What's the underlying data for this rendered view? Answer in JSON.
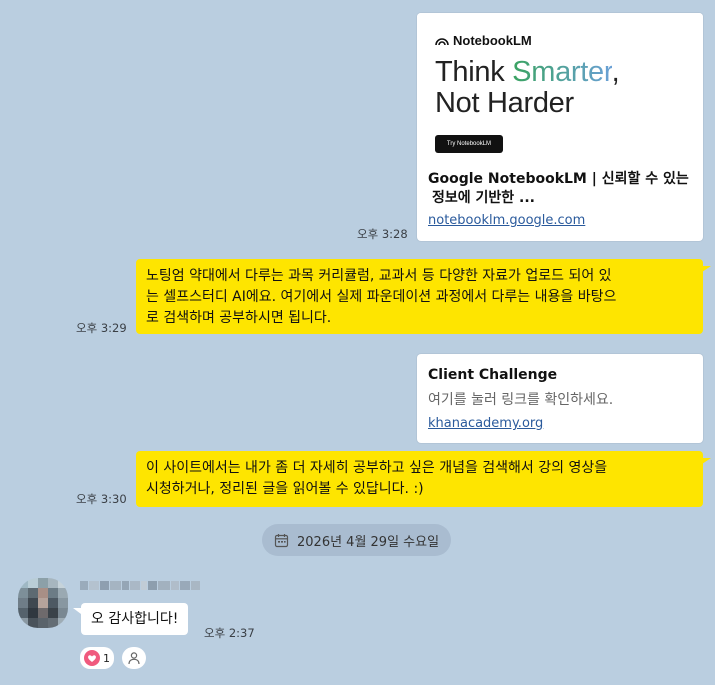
{
  "messages": {
    "link1": {
      "time": "오후 3:28",
      "brand": "NotebookLM",
      "hero_line1_a": "Think ",
      "hero_line1_b": "Smarter",
      "hero_line1_c": ",",
      "hero_line2": "Not Harder",
      "cta": "Try NotebookLM",
      "title_line1": "Google NotebookLM | 신뢰할 수 있는",
      "title_line2": "정보에 기반한 ...",
      "url": "notebooklm.google.com"
    },
    "text1": {
      "time": "오후 3:29",
      "line1": "노팅엄 약대에서 다루는 과목 커리큘럼, 교과서 등 다양한 자료가 업로드 되어 있",
      "line2": "는 셀프스터디 AI에요. 여기에서 실제 파운데이션 과정에서 다루는 내용을 바탕으",
      "line3": "로 검색하며 공부하시면 됩니다."
    },
    "link2": {
      "title": "Client Challenge",
      "desc": "여기를 눌러 링크를 확인하세요.",
      "url": "khanacademy.org"
    },
    "text2": {
      "time": "오후 3:30",
      "line1": "이 사이트에서는 내가 좀 더 자세히 공부하고 싶은 개념을 검색해서 강의 영상을",
      "line2": "시청하거나, 정리된 글을 읽어볼 수 있답니다. :)"
    },
    "date_divider": "2026년 4월 29일 수요일",
    "incoming": {
      "text": "오 감사합니다!",
      "time": "오후 2:37",
      "reaction_count": "1"
    }
  },
  "icons": {
    "calendar": "calendar-icon",
    "heart": "heart-icon",
    "add_reaction": "person-icon"
  },
  "colors": {
    "background": "#bacee0",
    "my_bubble": "#fee500",
    "their_bubble": "#ffffff",
    "link": "#2a5a9c"
  }
}
